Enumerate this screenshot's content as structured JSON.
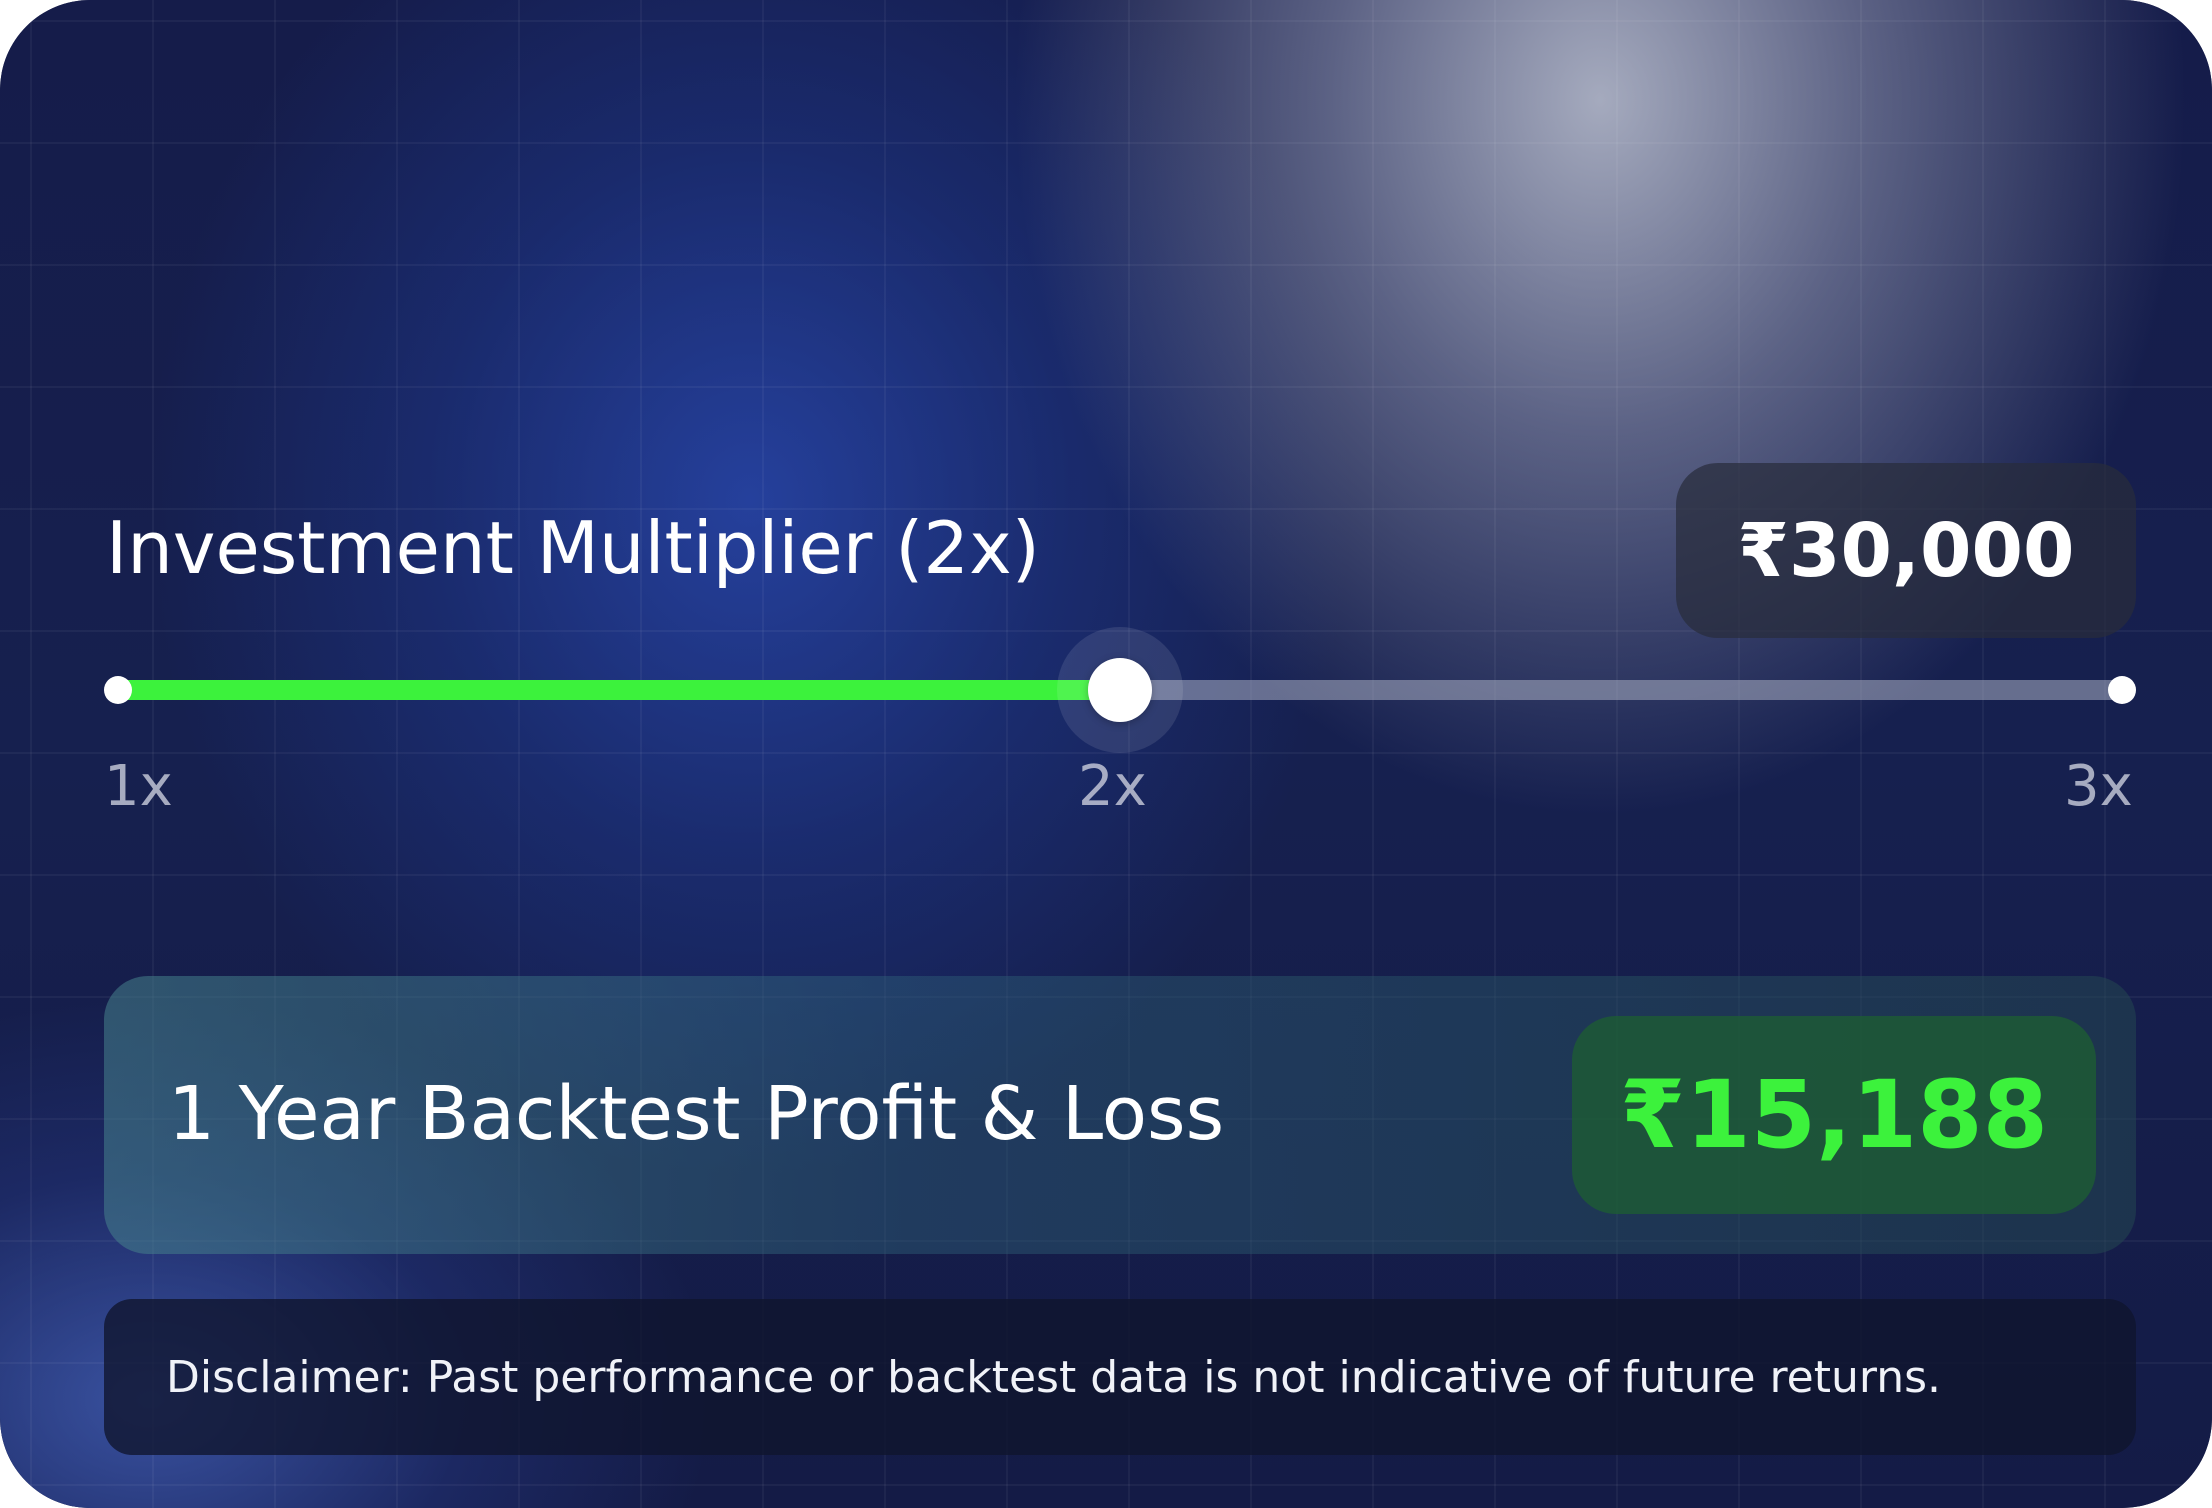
{
  "multiplier": {
    "label": "Investment Multiplier (2x)",
    "amount": "₹30,000",
    "slider": {
      "min_label": "1x",
      "mid_label": "2x",
      "max_label": "3x",
      "min": 1,
      "max": 3,
      "value": 2
    }
  },
  "backtest": {
    "label": "1 Year Backtest Profit & Loss",
    "value": "₹15,188"
  },
  "disclaimer": {
    "text": "Disclaimer: Past performance or backtest data is not indicative of future returns."
  },
  "colors": {
    "accent_green": "#3cf23c",
    "background": "#141a45"
  }
}
